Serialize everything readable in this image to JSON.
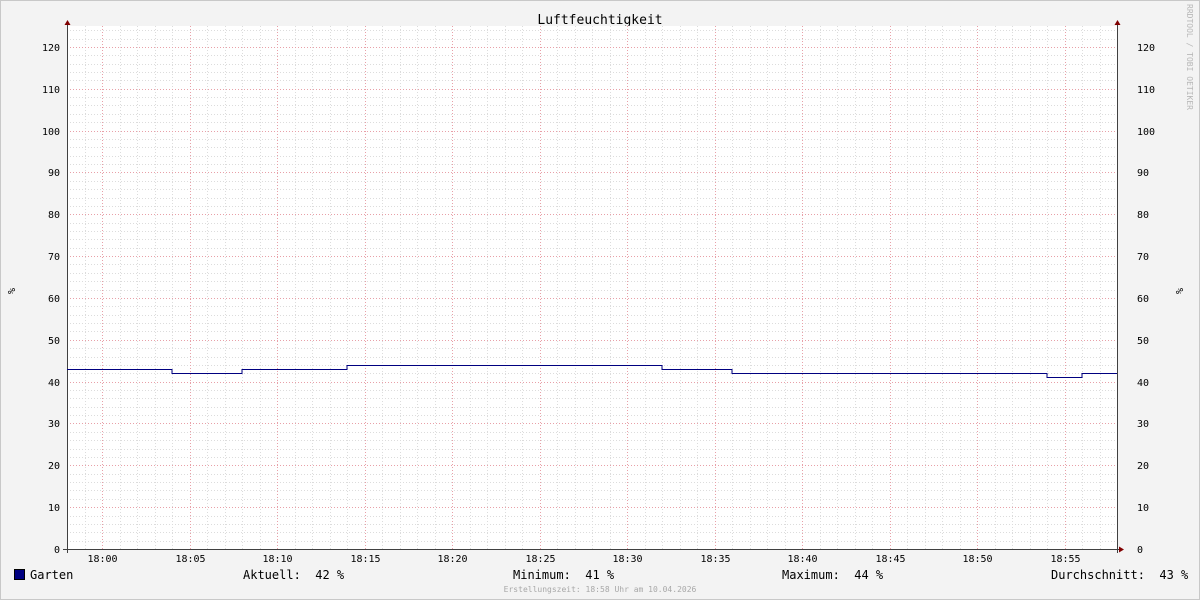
{
  "chart_data": {
    "type": "line",
    "title": "Luftfeuchtigkeit",
    "ylabel": "%",
    "ylim": [
      0,
      125
    ],
    "y_ticks": [
      0,
      10,
      20,
      30,
      40,
      50,
      60,
      70,
      80,
      90,
      100,
      110,
      120
    ],
    "x_range": [
      "17:58",
      "18:58"
    ],
    "x_tick_labels": [
      "18:00",
      "18:05",
      "18:10",
      "18:15",
      "18:20",
      "18:25",
      "18:30",
      "18:35",
      "18:40",
      "18:45",
      "18:50",
      "18:55"
    ],
    "grid": true,
    "series": [
      {
        "name": "Garten",
        "color": "#000080",
        "step": true,
        "points": [
          [
            "17:58",
            43
          ],
          [
            "18:04",
            42
          ],
          [
            "18:08",
            43
          ],
          [
            "18:14",
            44
          ],
          [
            "18:32",
            43
          ],
          [
            "18:36",
            42
          ],
          [
            "18:54",
            41
          ],
          [
            "18:56",
            42
          ],
          [
            "18:58",
            42
          ]
        ]
      }
    ],
    "watermark": "RRDTOOL / TOBI OETIKER"
  },
  "legend": {
    "series_name": "Garten",
    "series_color": "#000080",
    "current_label": "Aktuell:",
    "current_value": "42 %",
    "min_label": "Minimum:",
    "min_value": "41 %",
    "max_label": "Maximum:",
    "max_value": "44 %",
    "avg_label": "Durchschnitt:",
    "avg_value": "43 %"
  },
  "footer": "Erstellungszeit: 18:58 Uhr am 10.04.2026"
}
